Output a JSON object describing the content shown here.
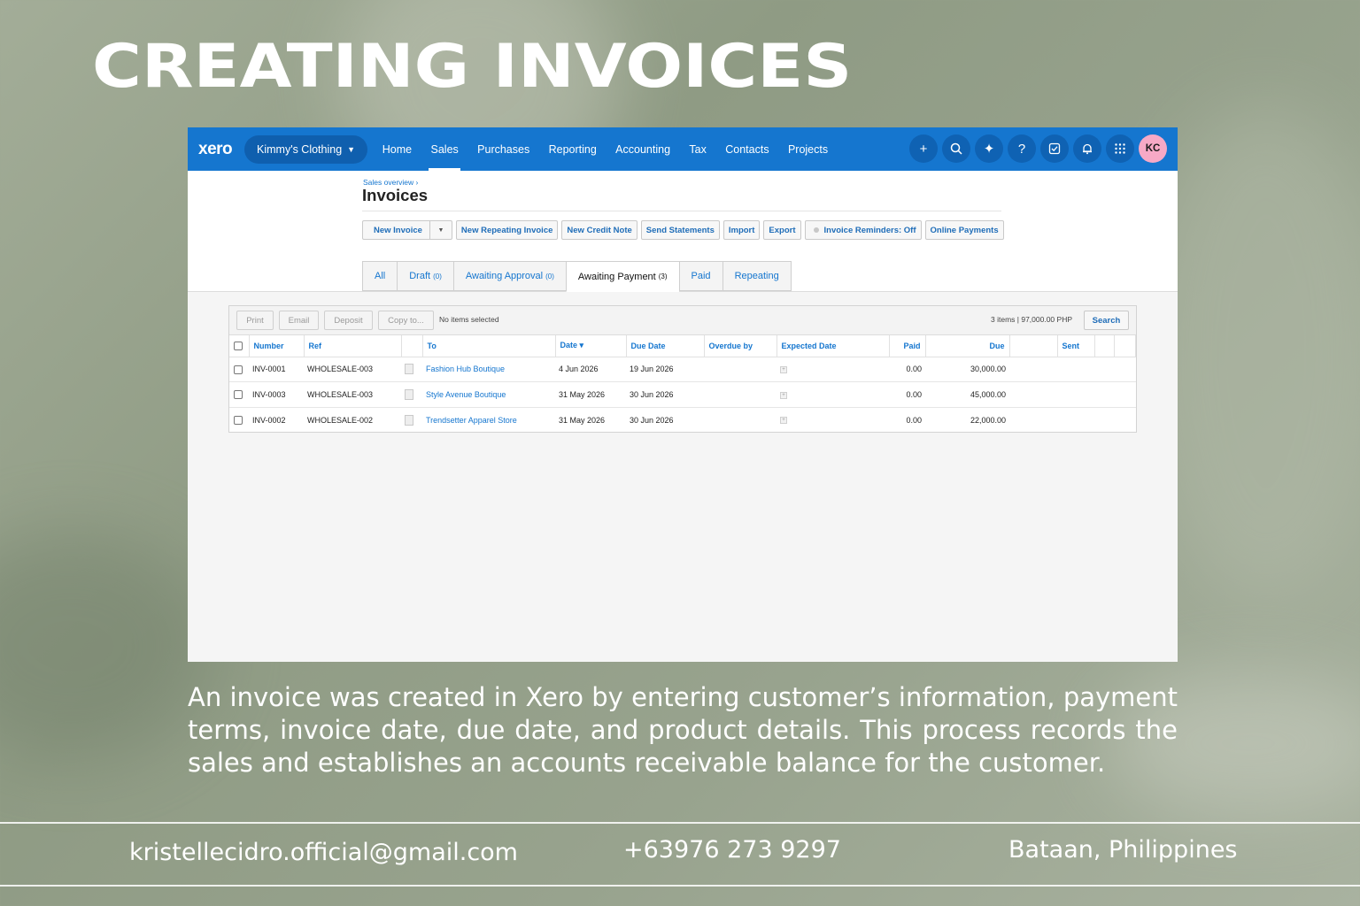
{
  "headline": "CREATING INVOICES",
  "app": {
    "logo": "xero",
    "org_name": "Kimmy's Clothing",
    "nav": [
      "Home",
      "Sales",
      "Purchases",
      "Reporting",
      "Accounting",
      "Tax",
      "Contacts",
      "Projects"
    ],
    "active_nav": "Sales",
    "nav_icons": [
      "plus-icon",
      "search-icon",
      "sparkle-icon",
      "help-icon",
      "checklist-icon",
      "bell-icon",
      "apps-grid-icon"
    ],
    "avatar_initials": "KC",
    "avatar_color": "#f7a9c6",
    "brand_color": "#1576cf",
    "breadcrumb": "Sales overview ›",
    "page_title": "Invoices",
    "actions": {
      "new_invoice": "New Invoice",
      "new_repeating": "New Repeating Invoice",
      "new_credit_note": "New Credit Note",
      "send_statements": "Send Statements",
      "import": "Import",
      "export": "Export",
      "reminders": "Invoice Reminders: Off",
      "online_payments": "Online Payments"
    },
    "tabs": [
      {
        "label": "All",
        "count": ""
      },
      {
        "label": "Draft",
        "count": "(0)"
      },
      {
        "label": "Awaiting Approval",
        "count": "(0)"
      },
      {
        "label": "Awaiting Payment",
        "count": "(3)"
      },
      {
        "label": "Paid",
        "count": ""
      },
      {
        "label": "Repeating",
        "count": ""
      }
    ],
    "active_tab": "Awaiting Payment",
    "toolbar": {
      "print": "Print",
      "email": "Email",
      "deposit": "Deposit",
      "copy_to": "Copy to...",
      "selection": "No items selected",
      "totals": "3 items  |  97,000.00  PHP",
      "search": "Search"
    },
    "columns": [
      "Number",
      "Ref",
      "To",
      "Date ▾",
      "Due Date",
      "Overdue by",
      "Expected Date",
      "Paid",
      "Due",
      "Sent"
    ],
    "rows": [
      {
        "number": "INV-0001",
        "ref": "WHOLESALE-003",
        "to": "Fashion Hub Boutique",
        "date": "4 Jun 2026",
        "due_date": "19 Jun 2026",
        "overdue_by": "",
        "paid": "0.00",
        "due": "30,000.00",
        "sent": ""
      },
      {
        "number": "INV-0003",
        "ref": "WHOLESALE-003",
        "to": "Style Avenue Boutique",
        "date": "31 May 2026",
        "due_date": "30 Jun 2026",
        "overdue_by": "",
        "paid": "0.00",
        "due": "45,000.00",
        "sent": ""
      },
      {
        "number": "INV-0002",
        "ref": "WHOLESALE-002",
        "to": "Trendsetter Apparel Store",
        "date": "31 May 2026",
        "due_date": "30 Jun 2026",
        "overdue_by": "",
        "paid": "0.00",
        "due": "22,000.00",
        "sent": ""
      }
    ]
  },
  "caption": "An invoice was created in Xero by entering customer’s information, payment terms, invoice date, due date, and product details. This process records the sales and establishes an accounts receivable balance for the customer.",
  "footer": {
    "email": "kristellecidro.official@gmail.com",
    "phone": "+63976 273 9297",
    "location": "Bataan, Philippines"
  }
}
